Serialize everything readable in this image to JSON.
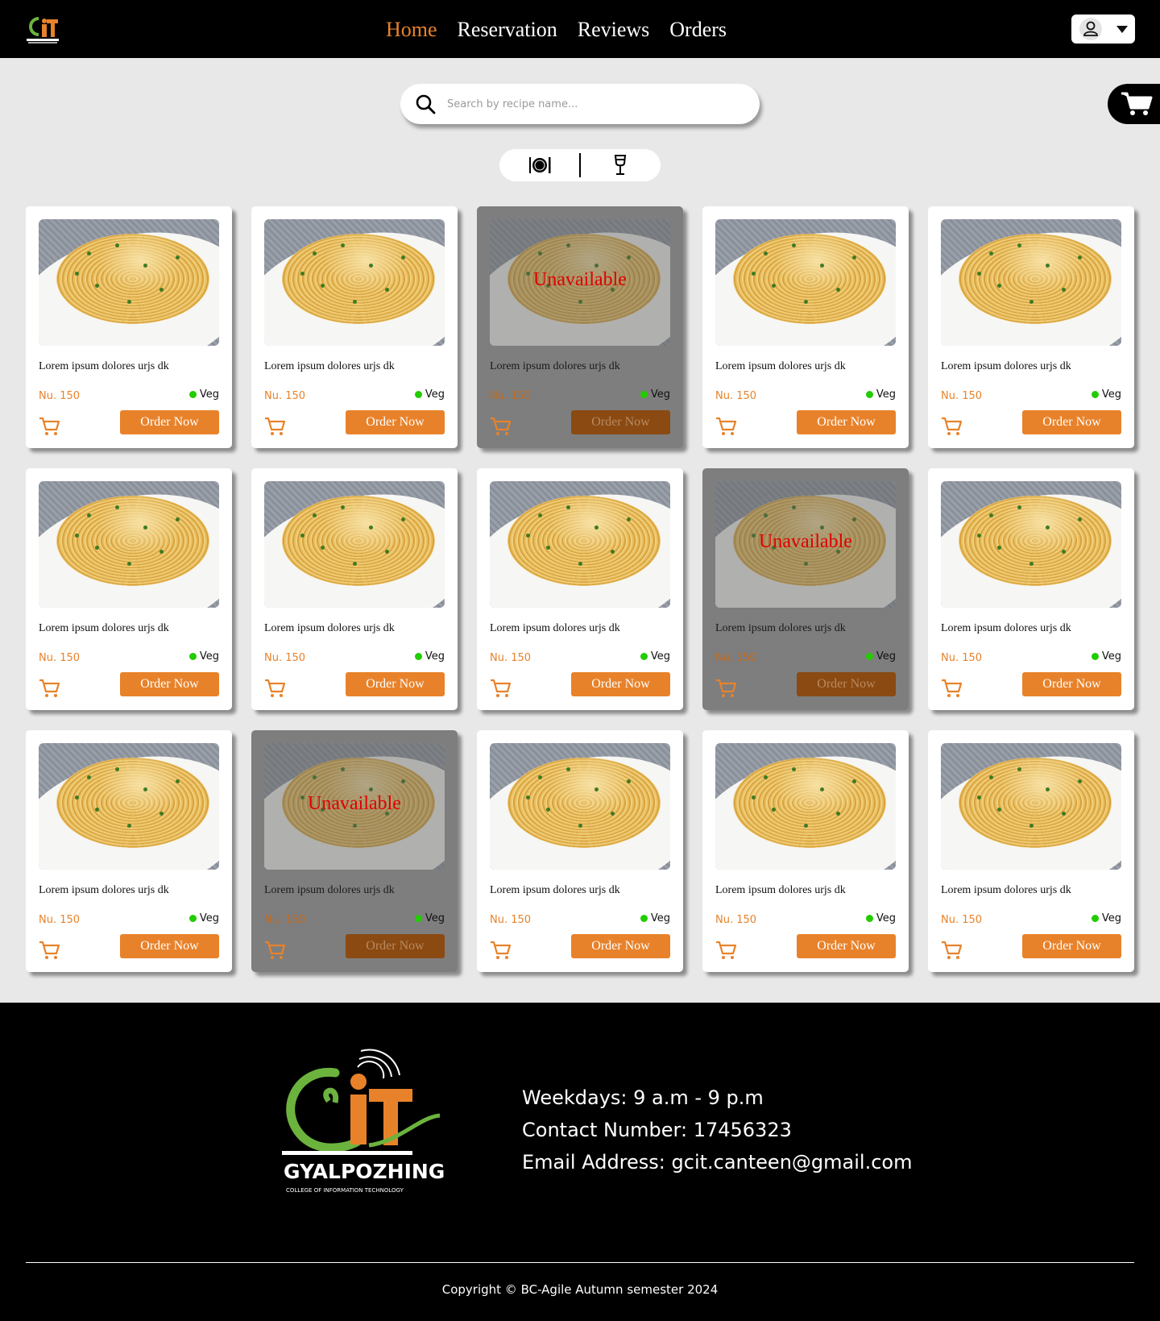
{
  "header": {
    "logo_alt": "GCIT logo",
    "nav": [
      {
        "label": "Home",
        "active": true
      },
      {
        "label": "Reservation",
        "active": false
      },
      {
        "label": "Reviews",
        "active": false
      },
      {
        "label": "Orders",
        "active": false
      }
    ],
    "user_icon": "user-icon",
    "dropdown_icon": "caret-down-icon"
  },
  "search": {
    "placeholder": "Search by recipe name...",
    "value": "",
    "icon": "search-icon"
  },
  "cart_button_icon": "cart-icon",
  "category_toggle": {
    "food_icon": "plate-cutlery-icon",
    "drinks_icon": "wine-glass-icon"
  },
  "colors": {
    "accent": "#e8822a",
    "header_bg": "#000000",
    "page_bg": "#e8e8e8",
    "veg_dot": "#22cc00",
    "unavailable_text": "#e00000"
  },
  "card_common": {
    "order_label": "Order Now",
    "unavailable_label": "Unavailable",
    "add_to_cart_icon": "add-to-cart-icon"
  },
  "products": [
    {
      "title": "Lorem ipsum dolores urjs dk",
      "price": "Nu. 150",
      "diet": "Veg",
      "available": true
    },
    {
      "title": "Lorem ipsum dolores urjs dk",
      "price": "Nu. 150",
      "diet": "Veg",
      "available": true
    },
    {
      "title": "Lorem ipsum dolores urjs dk",
      "price": "Nu. 150",
      "diet": "Veg",
      "available": false
    },
    {
      "title": "Lorem ipsum dolores urjs dk",
      "price": "Nu. 150",
      "diet": "Veg",
      "available": true
    },
    {
      "title": "Lorem ipsum dolores urjs dk",
      "price": "Nu. 150",
      "diet": "Veg",
      "available": true
    },
    {
      "title": "Lorem ipsum dolores urjs dk",
      "price": "Nu. 150",
      "diet": "Veg",
      "available": true
    },
    {
      "title": "Lorem ipsum dolores urjs dk",
      "price": "Nu. 150",
      "diet": "Veg",
      "available": true
    },
    {
      "title": "Lorem ipsum dolores urjs dk",
      "price": "Nu. 150",
      "diet": "Veg",
      "available": true
    },
    {
      "title": "Lorem ipsum dolores urjs dk",
      "price": "Nu. 150",
      "diet": "Veg",
      "available": false
    },
    {
      "title": "Lorem ipsum dolores urjs dk",
      "price": "Nu. 150",
      "diet": "Veg",
      "available": true
    },
    {
      "title": "Lorem ipsum dolores urjs dk",
      "price": "Nu. 150",
      "diet": "Veg",
      "available": true
    },
    {
      "title": "Lorem ipsum dolores urjs dk",
      "price": "Nu. 150",
      "diet": "Veg",
      "available": false
    },
    {
      "title": "Lorem ipsum dolores urjs dk",
      "price": "Nu. 150",
      "diet": "Veg",
      "available": true
    },
    {
      "title": "Lorem ipsum dolores urjs dk",
      "price": "Nu. 150",
      "diet": "Veg",
      "available": true
    },
    {
      "title": "Lorem ipsum dolores urjs dk",
      "price": "Nu. 150",
      "diet": "Veg",
      "available": true
    }
  ],
  "footer": {
    "logo_name": "GYALPOZHING",
    "logo_tagline": "COLLEGE OF INFORMATION TECHNOLOGY",
    "hours": "Weekdays: 9 a.m - 9 p.m",
    "contact": "Contact Number: 17456323",
    "email": "Email Address: gcit.canteen@gmail.com",
    "copyright": "Copyright © BC-Agile Autumn semester 2024"
  }
}
